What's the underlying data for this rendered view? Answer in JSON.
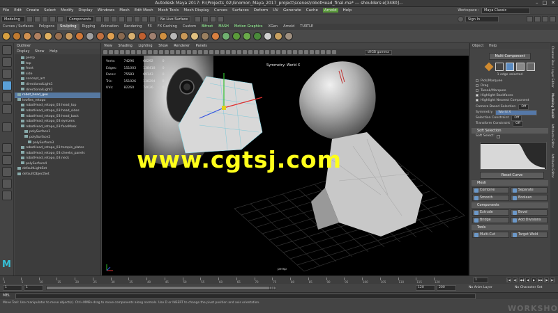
{
  "window": {
    "title": "Autodesk Maya 2017: R:\\Projects_02\\Gnomon_Maya_2017_project\\scenes\\robotHead_final.ma*  ---  shoulders:e[3480]...",
    "controls": [
      "–",
      "□",
      "✕"
    ]
  },
  "menubar": {
    "items": [
      "File",
      "Edit",
      "Create",
      "Select",
      "Modify",
      "Display",
      "Windows",
      "Mesh",
      "Edit Mesh",
      "Mesh Tools",
      "Mesh Display",
      "Curves",
      "Surfaces",
      "Deform",
      "UV",
      "Generate",
      "Cache",
      "Arnold",
      "Help"
    ],
    "workspace_label": "Workspace :",
    "workspace_value": "Maya Classic"
  },
  "statusline": {
    "mode": "Modeling",
    "selection_mode": "Components",
    "no_live_surface": "No Live Surface",
    "sign_in": "Sign In"
  },
  "shelf_tabs": [
    {
      "label": "Curves / Surfaces",
      "state": "normal"
    },
    {
      "label": "Polygons",
      "state": "normal"
    },
    {
      "label": "Sculpting",
      "state": "active"
    },
    {
      "label": "Rigging",
      "state": "normal"
    },
    {
      "label": "Animation",
      "state": "normal"
    },
    {
      "label": "Rendering",
      "state": "normal"
    },
    {
      "label": "FX",
      "state": "normal"
    },
    {
      "label": "FX Caching",
      "state": "normal"
    },
    {
      "label": "Custom",
      "state": "normal"
    },
    {
      "label": "Bifrost",
      "state": "green"
    },
    {
      "label": "MASH",
      "state": "green"
    },
    {
      "label": "Motion Graphics",
      "state": "green"
    },
    {
      "label": "XGen",
      "state": "normal"
    },
    {
      "label": "Arnold",
      "state": "normal"
    },
    {
      "label": "TURTLE",
      "state": "normal"
    }
  ],
  "shelf_icon_colors": [
    "#d8a040",
    "#c07a30",
    "#d09050",
    "#b08060",
    "#e0b060",
    "#9a7050",
    "#c89a60",
    "#d07838",
    "#a0a0a0",
    "#c07040",
    "#e0a050",
    "#8a6a50",
    "#d8b070",
    "#c06030",
    "#a08070",
    "#d09040",
    "#b8b8b8",
    "#c89858",
    "#e0c080",
    "#9a8060",
    "#d88040",
    "#70b070",
    "#5a9a3a",
    "#6aaa4a",
    "#4a8a3a",
    "#d0d0d0",
    "#c8a060",
    "#a09080"
  ],
  "outliner": {
    "title": "Outliner",
    "menu": [
      "Display",
      "Show",
      "Help"
    ],
    "items": [
      {
        "label": "persp",
        "indent": 1,
        "selected": false
      },
      {
        "label": "top",
        "indent": 1,
        "selected": false
      },
      {
        "label": "front",
        "indent": 1,
        "selected": false
      },
      {
        "label": "side",
        "indent": 1,
        "selected": false
      },
      {
        "label": "concept_art",
        "indent": 1,
        "selected": false
      },
      {
        "label": "directionalLight1",
        "indent": 1,
        "selected": false
      },
      {
        "label": "directionalLight2",
        "indent": 1,
        "selected": false
      },
      {
        "label": "robot_head_geo",
        "indent": 0,
        "selected": true
      },
      {
        "label": "lowRes_retopo",
        "indent": 0,
        "selected": false
      },
      {
        "label": "robotHead_retopo_03:head_top",
        "indent": 1,
        "selected": false
      },
      {
        "label": "robotHead_retopo_03:head_sides",
        "indent": 1,
        "selected": false
      },
      {
        "label": "robotHead_retopo_03:head_back",
        "indent": 1,
        "selected": false
      },
      {
        "label": "robotHead_retopo_03:eyeLens",
        "indent": 1,
        "selected": false
      },
      {
        "label": "robotHead_retopo_03:faceMask",
        "indent": 1,
        "selected": false
      },
      {
        "label": "polySurface1",
        "indent": 2,
        "selected": false
      },
      {
        "label": "polySurface2",
        "indent": 2,
        "selected": false
      },
      {
        "label": "polySurface3",
        "indent": 3,
        "selected": false
      },
      {
        "label": "robotHead_retopo_03:temple_plates",
        "indent": 1,
        "selected": false
      },
      {
        "label": "robotHead_retopo_03:cheeks_panels",
        "indent": 1,
        "selected": false
      },
      {
        "label": "robotHead_retopo_03:neck",
        "indent": 1,
        "selected": false
      },
      {
        "label": "polySurface4",
        "indent": 1,
        "selected": false
      },
      {
        "label": "defaultLightSet",
        "indent": 0,
        "selected": false
      },
      {
        "label": "defaultObjectSet",
        "indent": 0,
        "selected": false
      }
    ]
  },
  "viewport": {
    "menu": [
      "View",
      "Shading",
      "Lighting",
      "Show",
      "Renderer",
      "Panels"
    ],
    "color_space": "sRGB gamma",
    "hud": [
      {
        "label": "Verts:",
        "a": "74296",
        "b": "68292",
        "c": "0"
      },
      {
        "label": "Edges:",
        "a": "151003",
        "b": "138418",
        "c": "0"
      },
      {
        "label": "Faces:",
        "a": "75583",
        "b": "69143",
        "c": "0"
      },
      {
        "label": "Tris:",
        "a": "151026",
        "b": "138294",
        "c": "0"
      },
      {
        "label": "UVs:",
        "a": "82260",
        "b": "74026",
        "c": "0"
      }
    ],
    "symmetry": "Symmetry: World X",
    "camera": "persp",
    "watermark": "www.cgtsj.com"
  },
  "modeling_toolkit": {
    "menu": [
      "Object",
      "Help"
    ],
    "title": "Multi-Component",
    "edge_selected": "1 edge selected",
    "selection_options": [
      {
        "label": "Pick/Marquee",
        "checked": false
      },
      {
        "label": "Drag",
        "checked": false
      },
      {
        "label": "Tweak/Marquee",
        "checked": false
      },
      {
        "label": "Highlight Backfaces",
        "checked": true
      },
      {
        "label": "Highlight Nearest Component",
        "checked": true
      }
    ],
    "camera_based_selection_label": "Camera Based Selection",
    "camera_based_selection_value": "Off",
    "symmetry_label": "Symmetry",
    "symmetry_value": "World X",
    "selection_constraint_label": "Selection Constraint",
    "selection_constraint_value": "Off",
    "transform_constraint_label": "Transform Constraint",
    "transform_constraint_value": "Off",
    "soft_selection": "Soft Selection",
    "soft_select_label": "Soft Select:",
    "reset_curve": "Reset Curve",
    "mesh_header": "Mesh",
    "mesh_buttons": [
      "Combine",
      "Separate",
      "Smooth",
      "Boolean"
    ],
    "components_header": "Components",
    "component_buttons": [
      "Extrude",
      "Bevel",
      "Bridge",
      "Add Divisions"
    ],
    "tools_header": "Tools",
    "tool_buttons": [
      "Multi-Cut",
      "Target Weld"
    ]
  },
  "side_tabs": [
    "Channel Box / Layer Editor",
    "Modeling Toolkit",
    "Attribute Editor",
    "Attribute Editor"
  ],
  "timeslider": {
    "tick_labels": [
      "1",
      "5",
      "10",
      "15",
      "20",
      "25",
      "30",
      "35",
      "40",
      "45",
      "50",
      "55",
      "60",
      "65",
      "70",
      "75",
      "80",
      "85",
      "90",
      "95",
      "100",
      "105",
      "110",
      "115",
      "120"
    ],
    "current_frame": "1",
    "playback": [
      "|◀",
      "◀|",
      "◀◀",
      "◀",
      "▶",
      "▶▶",
      "|▶",
      "▶|"
    ]
  },
  "rangebar": {
    "start": "1",
    "start_inner": "1",
    "slider_end": "120",
    "end_inner": "120",
    "end": "200",
    "anim_layer": "No Anim Layer",
    "character_set": "No Character Set"
  },
  "cmdline": {
    "label": "MEL"
  },
  "helpline": {
    "text": "Move Tool: Use manipulator to move object(s). Ctrl+MMB+drag to move components along normals. Use D or INSERT to change the pivot position and axis orientation.",
    "corner": "WORKSHO"
  }
}
